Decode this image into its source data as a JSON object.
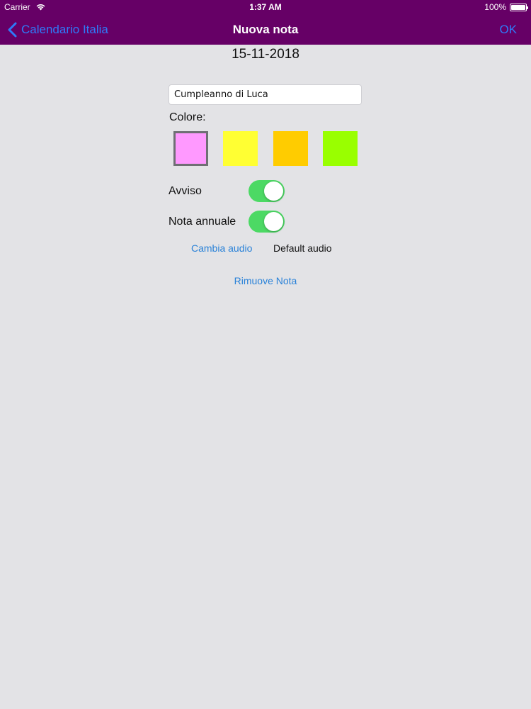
{
  "status_bar": {
    "carrier": "Carrier",
    "time": "1:37 AM",
    "battery": "100%",
    "battery_level": 1.0
  },
  "nav": {
    "back_label": "Calendario Italia",
    "title": "Nuova nota",
    "ok_label": "OK"
  },
  "date": "15-11-2018",
  "note": {
    "value": "Cumpleanno di Luca",
    "placeholder": ""
  },
  "colors": {
    "label": "Colore:",
    "swatches": [
      {
        "hex": "#ff99ff",
        "selected": true
      },
      {
        "hex": "#ffff33",
        "selected": false
      },
      {
        "hex": "#ffcc00",
        "selected": false
      },
      {
        "hex": "#99ff00",
        "selected": false
      }
    ]
  },
  "avviso": {
    "label": "Avviso",
    "on": true
  },
  "nota_annuale": {
    "label": "Nota annuale",
    "on": true
  },
  "audio": {
    "change_label": "Cambia audio",
    "current": "Default audio"
  },
  "remove_label": "Rimuove Nota",
  "accent": {
    "bar": "#660066",
    "link": "#2a82d8",
    "switch_on": "#4cd964"
  }
}
